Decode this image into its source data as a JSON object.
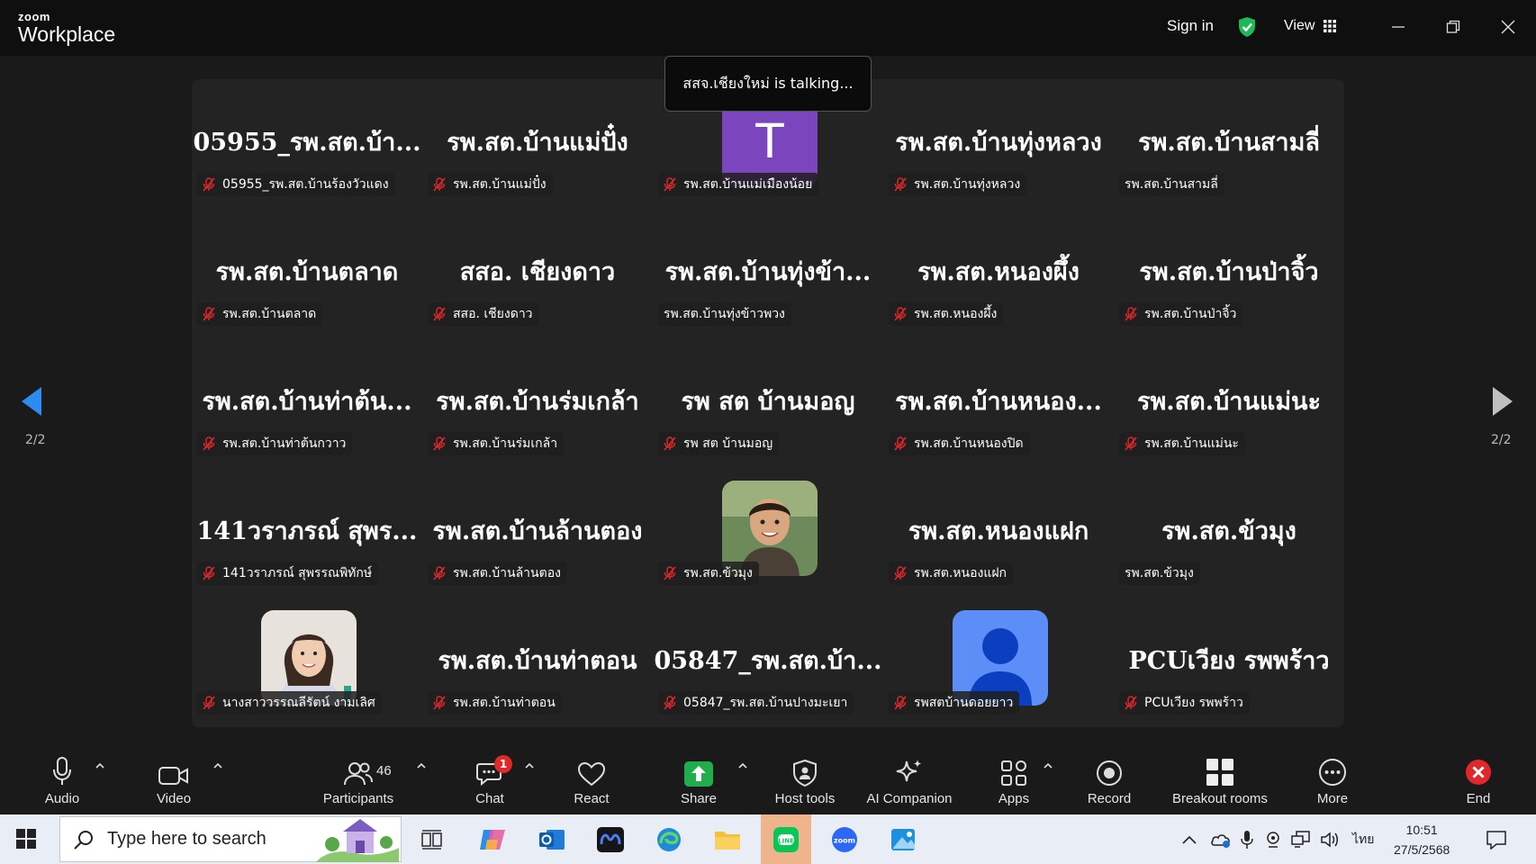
{
  "titlebar": {
    "logo_small": "zoom",
    "logo_big": "Workplace",
    "sign_in": "Sign in",
    "view": "View"
  },
  "talking_banner": "สสจ.เชียงใหม่ is talking...",
  "pagination": {
    "left": "2/2",
    "right": "2/2"
  },
  "tiles": [
    {
      "name": "05955_รพ.สต.บ้า...",
      "label": "05955_รพ.สต.บ้านร้องวัวแดง",
      "muted": true,
      "avatar": ""
    },
    {
      "name": "รพ.สต.บ้านแม่ปั๋ง",
      "label": "รพ.สต.บ้านแม่ปั๋ง",
      "muted": true,
      "avatar": ""
    },
    {
      "name": "",
      "label": "รพ.สต.บ้านแม่เมืองน้อย",
      "muted": true,
      "avatar": "T"
    },
    {
      "name": "รพ.สต.บ้านทุ่งหลวง",
      "label": "รพ.สต.บ้านทุ่งหลวง",
      "muted": true,
      "avatar": ""
    },
    {
      "name": "รพ.สต.บ้านสามลี่",
      "label": "รพ.สต.บ้านสามลี่",
      "muted": false,
      "avatar": ""
    },
    {
      "name": "รพ.สต.บ้านตลาด",
      "label": "รพ.สต.บ้านตลาด",
      "muted": true,
      "avatar": ""
    },
    {
      "name": "สสอ. เชียงดาว",
      "label": "สสอ. เชียงดาว",
      "muted": true,
      "avatar": ""
    },
    {
      "name": "รพ.สต.บ้านทุ่งข้า...",
      "label": "รพ.สต.บ้านทุ่งข้าวพวง",
      "muted": false,
      "avatar": ""
    },
    {
      "name": "รพ.สต.หนองผึ้ง",
      "label": "รพ.สต.หนองผึ้ง",
      "muted": true,
      "avatar": ""
    },
    {
      "name": "รพ.สต.บ้านป่าจิ้ว",
      "label": "รพ.สต.บ้านป่าจิ้ว",
      "muted": true,
      "avatar": ""
    },
    {
      "name": "รพ.สต.บ้านท่าต้น...",
      "label": "รพ.สต.บ้านท่าต้นกวาว",
      "muted": true,
      "avatar": ""
    },
    {
      "name": "รพ.สต.บ้านร่มเกล้า",
      "label": "รพ.สต.บ้านร่มเกล้า",
      "muted": true,
      "avatar": ""
    },
    {
      "name": "รพ สต บ้านมอญ",
      "label": "รพ สต บ้านมอญ",
      "muted": true,
      "avatar": ""
    },
    {
      "name": "รพ.สต.บ้านหนอง...",
      "label": "รพ.สต.บ้านหนองปิด",
      "muted": true,
      "avatar": ""
    },
    {
      "name": "รพ.สต.บ้านแม่นะ",
      "label": "รพ.สต.บ้านแม่นะ",
      "muted": true,
      "avatar": ""
    },
    {
      "name": "141วราภรณ์ สุพร...",
      "label": "141วราภรณ์ สุพรรณพิทักษ์",
      "muted": true,
      "avatar": ""
    },
    {
      "name": "รพ.สต.บ้านล้านตอง",
      "label": "รพ.สต.บ้านล้านตอง",
      "muted": true,
      "avatar": ""
    },
    {
      "name": "",
      "label": "รพ.สต.ข้วมุง",
      "muted": true,
      "avatar": "photo-boy"
    },
    {
      "name": "รพ.สต.หนองแฝก",
      "label": "รพ.สต.หนองแฝก",
      "muted": true,
      "avatar": ""
    },
    {
      "name": "รพ.สต.ข้วมุง",
      "label": "รพ.สต.ข้วมุง",
      "muted": false,
      "avatar": ""
    },
    {
      "name": "",
      "label": "นางสาววรรณลีรัตน์ งามเลิศ",
      "muted": true,
      "avatar": "photo-woman"
    },
    {
      "name": "รพ.สต.บ้านท่าตอน",
      "label": "รพ.สต.บ้านท่าตอน",
      "muted": true,
      "avatar": ""
    },
    {
      "name": "05847_รพ.สต.บ้า...",
      "label": "05847_รพ.สต.บ้านปางมะเยา",
      "muted": true,
      "avatar": ""
    },
    {
      "name": "",
      "label": "รพสตบ้านดอยยาว",
      "muted": true,
      "avatar": "default-person"
    },
    {
      "name": "PCUเวียง รพพร้าว",
      "label": "PCUเวียง รพพร้าว",
      "muted": true,
      "avatar": ""
    }
  ],
  "toolbar": {
    "audio": "Audio",
    "video": "Video",
    "participants": "Participants",
    "participants_count": "46",
    "chat": "Chat",
    "chat_badge": "1",
    "react": "React",
    "share": "Share",
    "host_tools": "Host tools",
    "ai_companion": "AI Companion",
    "apps": "Apps",
    "record": "Record",
    "breakout_rooms": "Breakout rooms",
    "more": "More",
    "end": "End"
  },
  "taskbar": {
    "search_placeholder": "Type here to search",
    "ime": "ไทย",
    "time": "10:51",
    "date": "27/5/2568"
  },
  "colors": {
    "accent_share": "#1fae4b",
    "end_red": "#e0282c",
    "shield_green": "#1db954",
    "avatar_purple": "#7b45bd",
    "avatar_blue": "#5d8df6",
    "nav_blue": "#2d8cf0"
  }
}
